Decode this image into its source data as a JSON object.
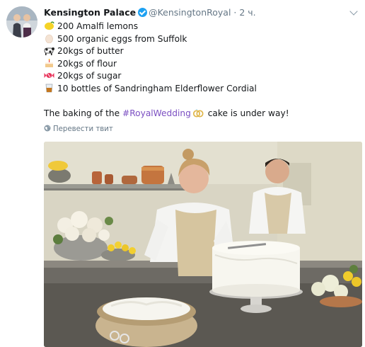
{
  "account": {
    "name": "Kensington Palace",
    "handle": "@KensingtonRoyal",
    "separator": "·",
    "time": "2 ч."
  },
  "tweet": {
    "lines": [
      {
        "icon": "lemon-icon",
        "text": "200 Amalfi lemons"
      },
      {
        "icon": "egg-icon",
        "text": "500 organic eggs from Suffolk"
      },
      {
        "icon": "cow-icon",
        "text": "20kgs of butter"
      },
      {
        "icon": "cake-icon",
        "text": "20kgs of flour"
      },
      {
        "icon": "candy-icon",
        "text": "20kgs of sugar"
      },
      {
        "icon": "tumbler-glass-icon",
        "text": "10 bottles of Sandringham Elderflower Cordial"
      }
    ],
    "closing_before": "The baking of the ",
    "hashtag": "#RoyalWedding",
    "hashtag_icon": "wedding-rings-icon",
    "closing_after": " cake is under way!"
  },
  "translate_label": "Перевести твит",
  "colors": {
    "text": "#14171a",
    "muted": "#657786",
    "hashtag": "#7b4fc2",
    "verified": "#1da1f2"
  }
}
